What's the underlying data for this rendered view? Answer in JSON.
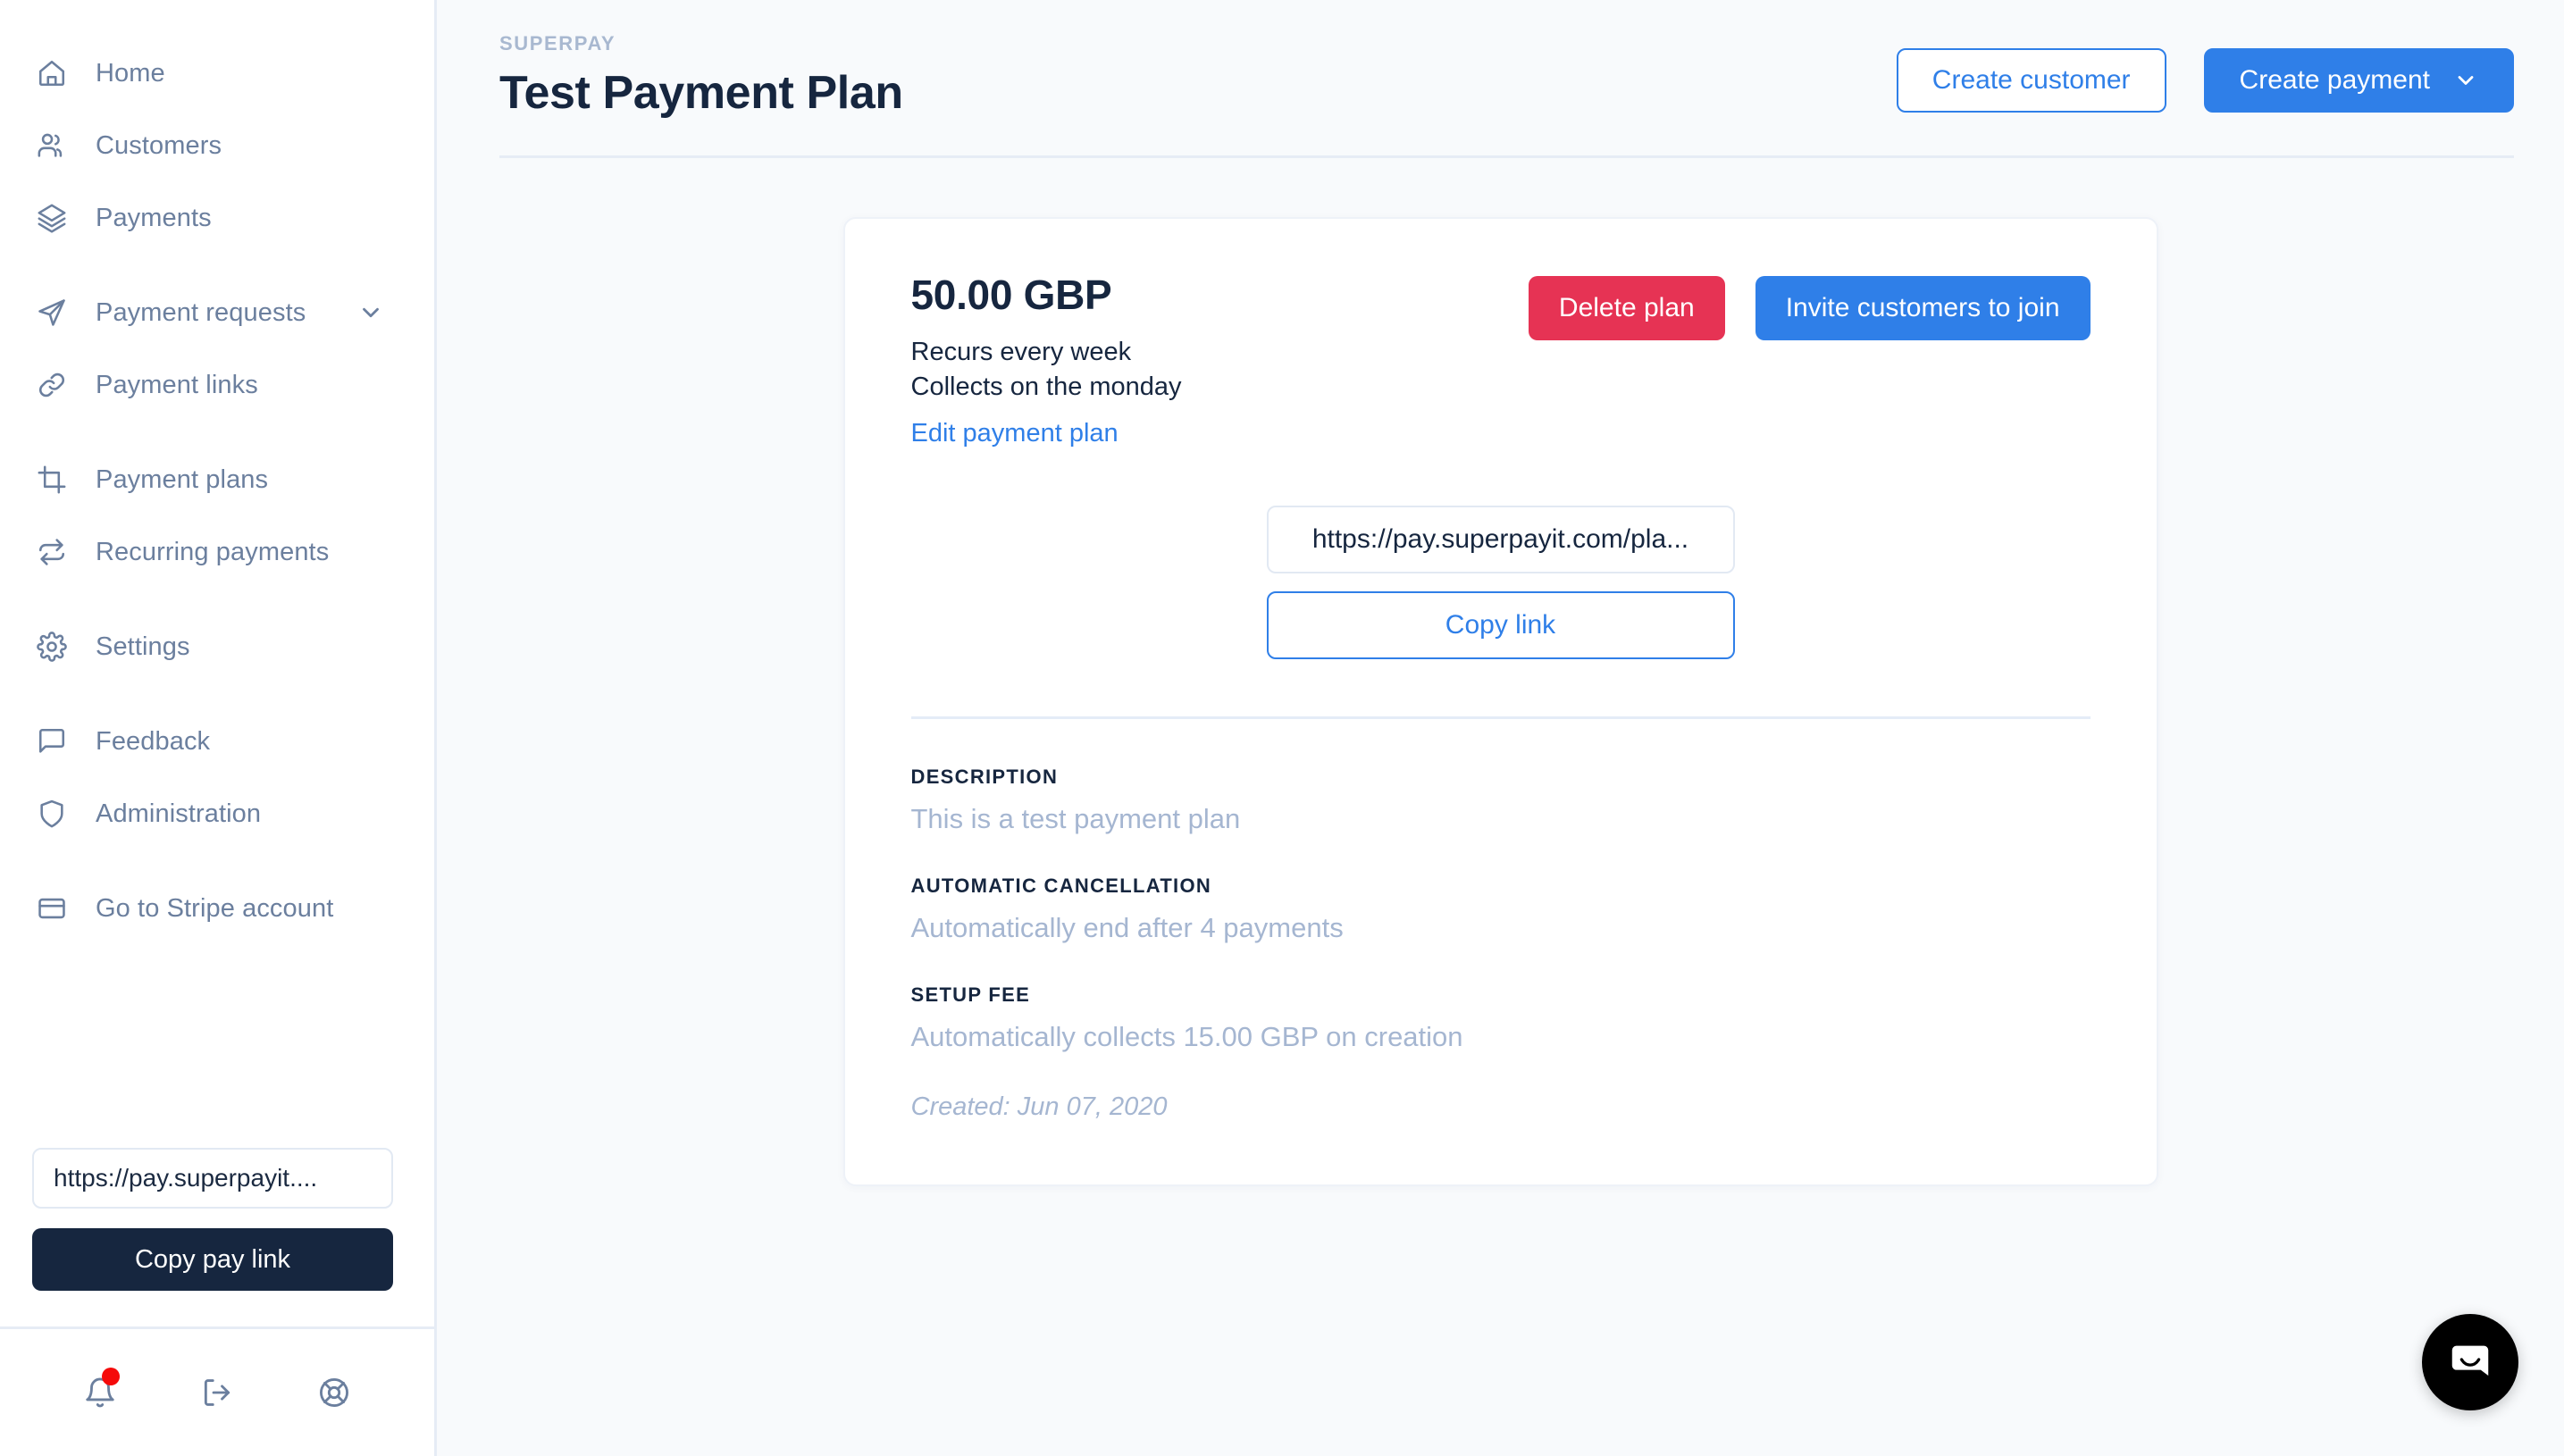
{
  "sidebar": {
    "items": [
      {
        "label": "Home",
        "icon": "home-icon",
        "has_chevron": false
      },
      {
        "label": "Customers",
        "icon": "users-icon",
        "has_chevron": false
      },
      {
        "label": "Payments",
        "icon": "layers-icon",
        "has_chevron": false
      },
      {
        "label": "Payment requests",
        "icon": "send-icon",
        "has_chevron": true
      },
      {
        "label": "Payment links",
        "icon": "link-icon",
        "has_chevron": false
      },
      {
        "label": "Payment plans",
        "icon": "crop-icon",
        "has_chevron": false
      },
      {
        "label": "Recurring payments",
        "icon": "repeat-icon",
        "has_chevron": false
      },
      {
        "label": "Settings",
        "icon": "gear-icon",
        "has_chevron": false
      },
      {
        "label": "Feedback",
        "icon": "message-square-icon",
        "has_chevron": false
      },
      {
        "label": "Administration",
        "icon": "shield-icon",
        "has_chevron": false
      },
      {
        "label": "Go to Stripe account",
        "icon": "credit-card-icon",
        "has_chevron": false
      }
    ],
    "pay_link_value": "https://pay.superpayit....",
    "copy_pay_link_label": "Copy pay link",
    "footer_icons": [
      {
        "name": "bell-icon",
        "has_badge": true
      },
      {
        "name": "logout-icon",
        "has_badge": false
      },
      {
        "name": "lifebuoy-icon",
        "has_badge": false
      }
    ]
  },
  "header": {
    "eyebrow": "SUPERPAY",
    "title": "Test Payment Plan",
    "create_customer_label": "Create customer",
    "create_payment_label": "Create payment"
  },
  "plan": {
    "amount": "50.00 GBP",
    "recurrence": "Recurs every week",
    "collection": "Collects on the monday",
    "edit_link_label": "Edit payment plan",
    "delete_label": "Delete plan",
    "invite_label": "Invite customers to join",
    "share_url": "https://pay.superpayit.com/pla...",
    "copy_link_label": "Copy link",
    "details": [
      {
        "label": "DESCRIPTION",
        "value": "This is a test payment plan"
      },
      {
        "label": "AUTOMATIC CANCELLATION",
        "value": "Automatically end after 4 payments"
      },
      {
        "label": "SETUP FEE",
        "value": "Automatically collects 15.00 GBP on creation"
      }
    ],
    "created": "Created: Jun 07, 2020"
  },
  "colors": {
    "accent_blue": "#2f7fe8",
    "danger_red": "#e63354",
    "dark_navy": "#16263f",
    "muted_slate": "#6b7f9e",
    "value_grey": "#a5b6d1",
    "badge_red": "#f50a0a"
  }
}
